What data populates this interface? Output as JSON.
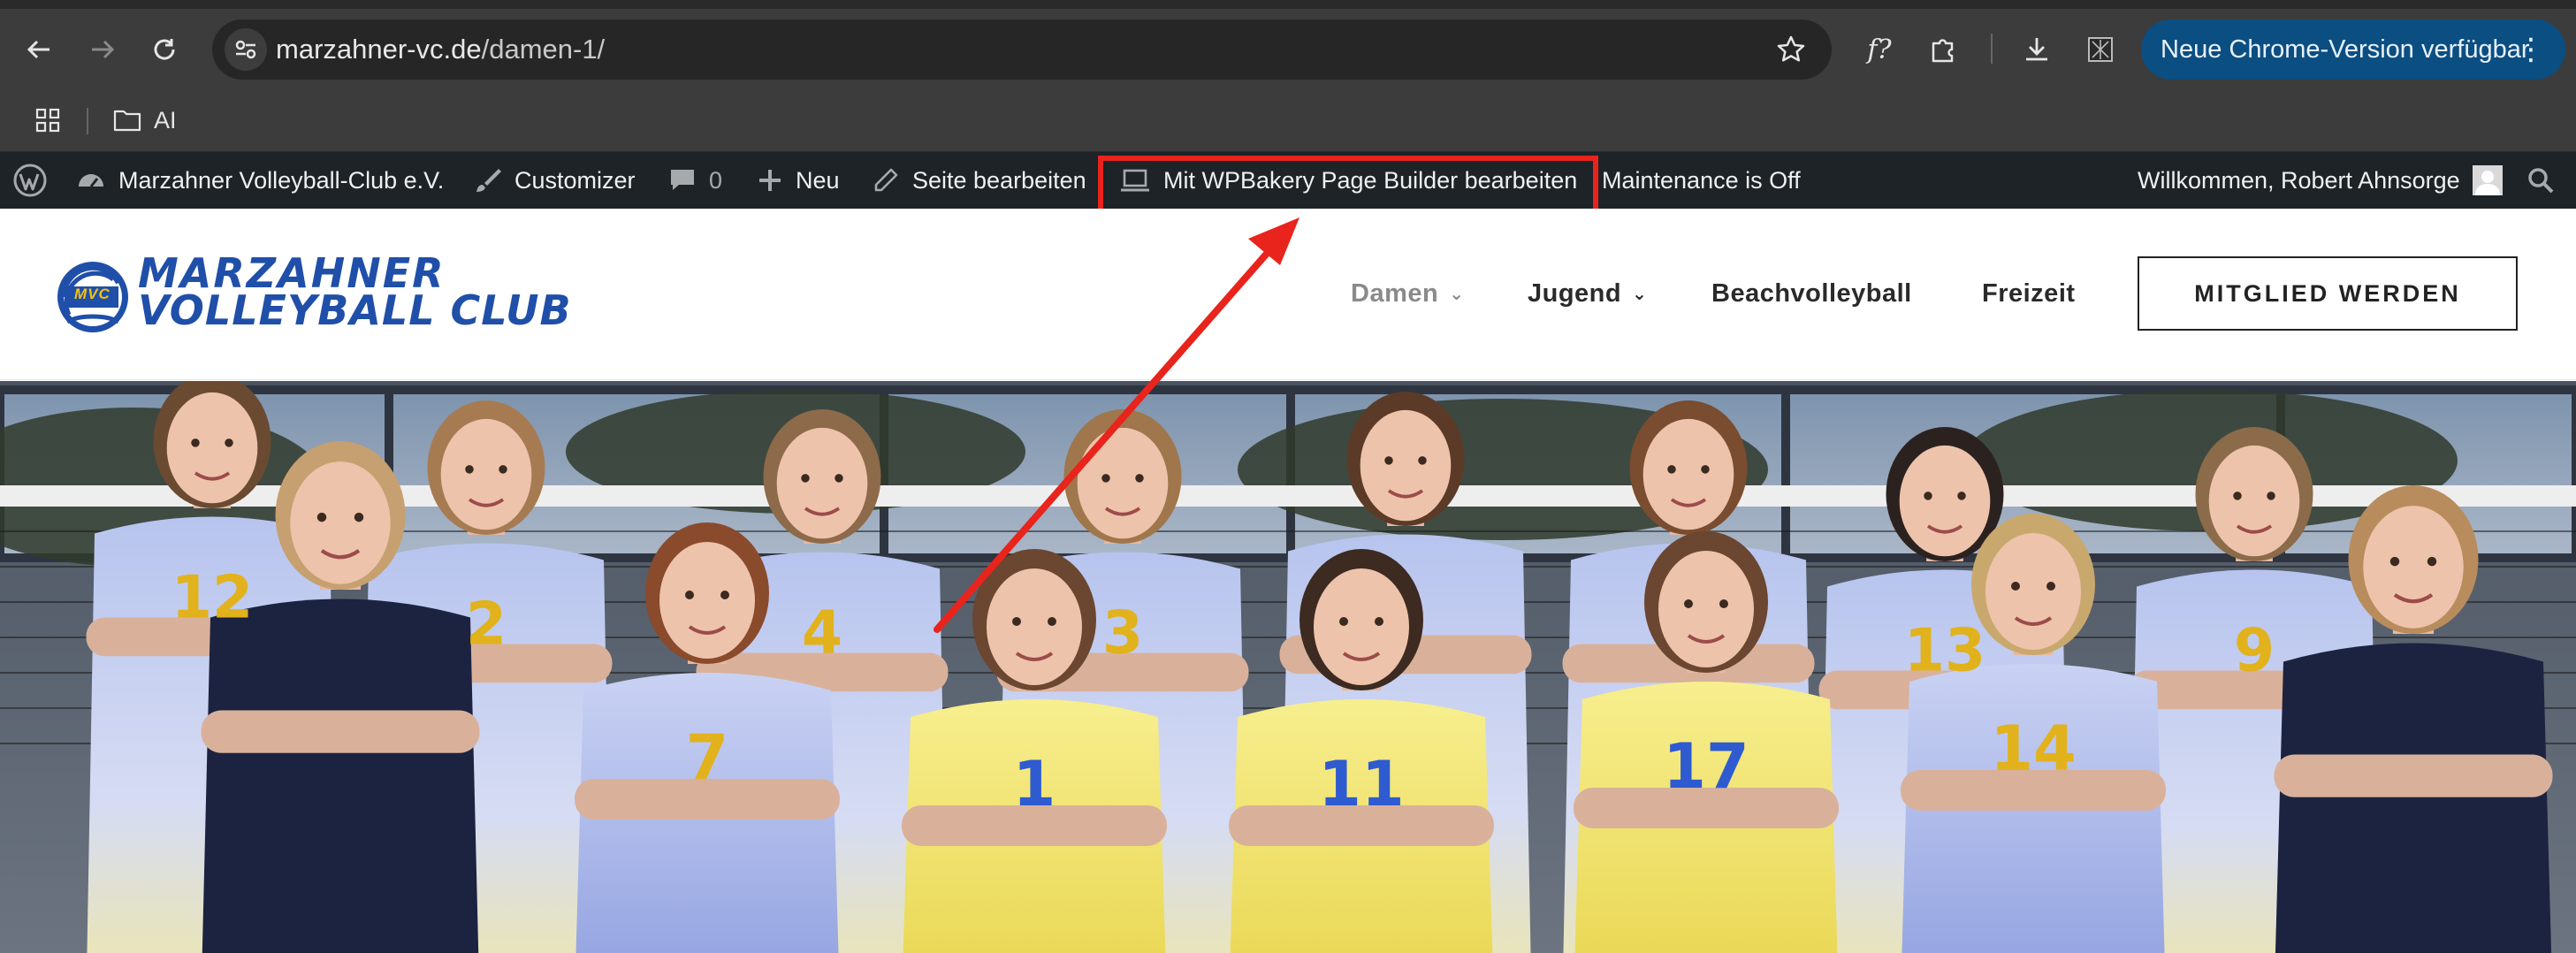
{
  "browser": {
    "url_host": "marzahner-vc.de",
    "url_path": "/damen-1/",
    "update_button": "Neue Chrome-Version verfügbar",
    "bookmark_folder": "AI",
    "icons": [
      "back-arrow-icon",
      "forward-arrow-icon",
      "reload-icon",
      "site-info-icon",
      "star-icon",
      "formula-extension-icon",
      "puzzle-icon",
      "download-icon",
      "extension-icon",
      "more-icon",
      "apps-grid-icon",
      "folder-icon"
    ]
  },
  "adminbar": {
    "site_name": "Marzahner Volleyball-Club e.V.",
    "customizer": "Customizer",
    "comments_count": "0",
    "new": "Neu",
    "edit_page": "Seite bearbeiten",
    "wpbakery": "Mit WPBakery Page Builder bearbeiten",
    "maintenance": "Maintenance is Off",
    "welcome": "Willkommen, Robert Ahnsorge"
  },
  "site": {
    "logo_line1": "MARZAHNER",
    "logo_line2": "VOLLEYBALL CLUB",
    "logo_badge": "MVC",
    "nav": [
      {
        "label": "Damen"
      },
      {
        "label": "Jugend"
      },
      {
        "label": "Beachvolleyball"
      },
      {
        "label": "Freizeit"
      }
    ],
    "cta": "MITGLIED WERDEN"
  },
  "hero": {
    "jersey_numbers_back": [
      "12",
      "2",
      "4",
      "3",
      "13",
      "9"
    ],
    "jersey_numbers_front": [
      "7",
      "1",
      "11",
      "17",
      "14"
    ]
  },
  "colors": {
    "annotation_red": "#e8241c",
    "brand_blue": "#1f4fa8",
    "adminbar": "#1d2327",
    "update_pill": "#0b4e82"
  }
}
